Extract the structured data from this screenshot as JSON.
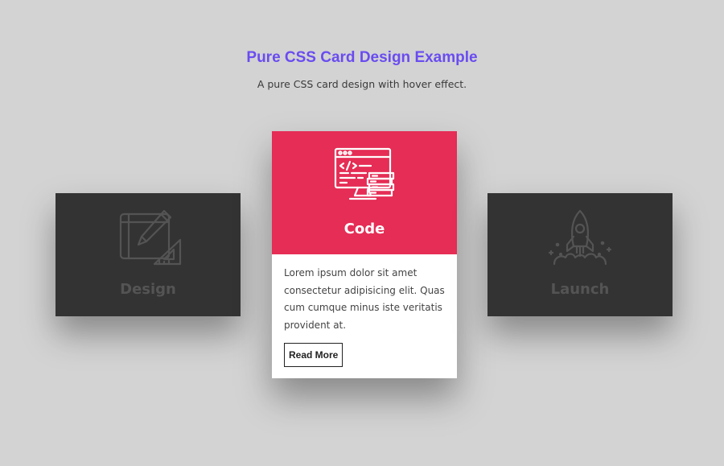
{
  "header": {
    "title": "Pure CSS Card Design Example",
    "subtitle": "A pure CSS card design with hover effect."
  },
  "cards": [
    {
      "label": "Design",
      "icon": "design-tools-icon"
    },
    {
      "label": "Code",
      "icon": "code-monitor-icon",
      "description": "Lorem ipsum dolor sit amet consectetur adipisicing elit. Quas cum cumque minus iste veritatis provident at.",
      "button_label": "Read More"
    },
    {
      "label": "Launch",
      "icon": "rocket-icon"
    }
  ],
  "colors": {
    "page_background": "#d3d3d3",
    "title": "#6a4cf0",
    "side_card_background": "#333333",
    "side_card_content": "#545454",
    "active_card_header": "#e52d55",
    "active_card_body": "#ffffff"
  }
}
